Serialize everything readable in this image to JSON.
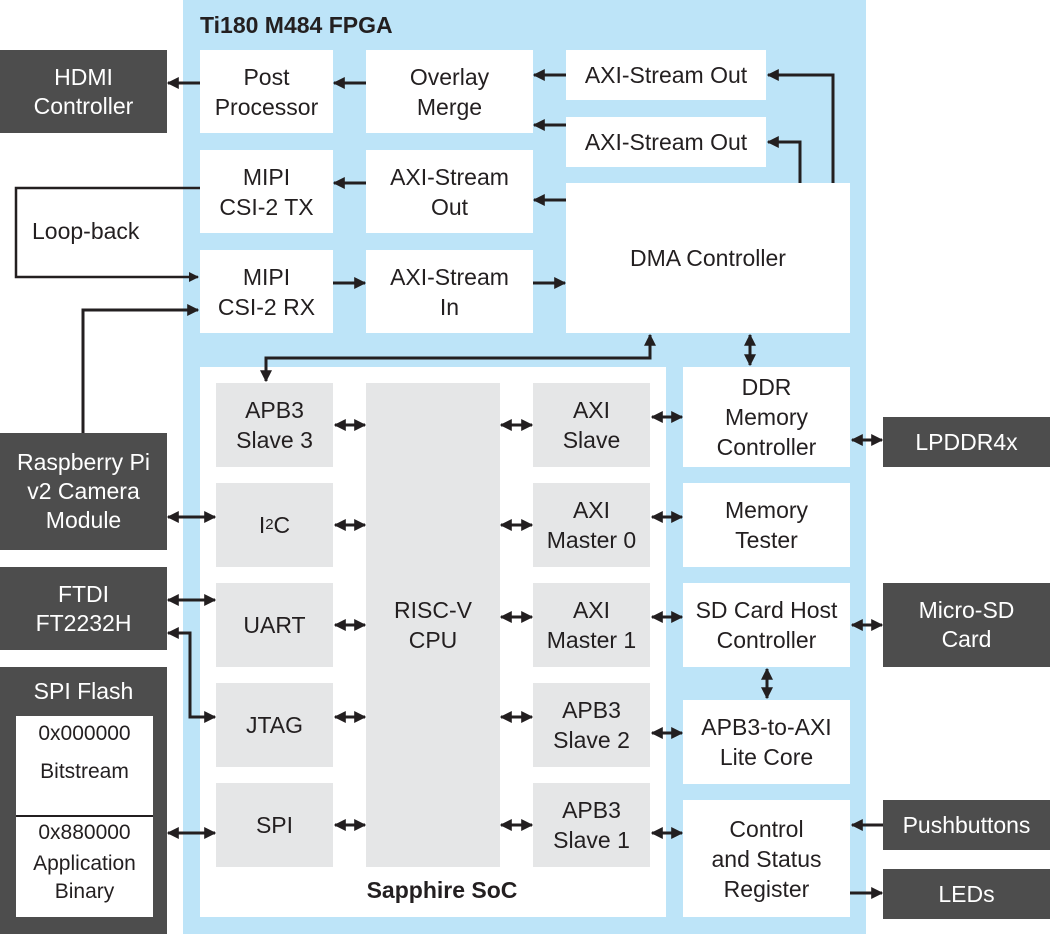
{
  "fpga": {
    "title": "Ti180 M484 FPGA"
  },
  "soc": {
    "title": "Sapphire SoC"
  },
  "video_path": {
    "post_processor": "Post\nProcessor",
    "overlay_merge": "Overlay\nMerge",
    "axi_stream_out_1": "AXI-Stream Out",
    "axi_stream_out_2": "AXI-Stream Out",
    "mipi_tx": "MIPI\nCSI-2 TX",
    "axi_stream_out_3": "AXI-Stream\nOut",
    "mipi_rx": "MIPI\nCSI-2 RX",
    "axi_stream_in": "AXI-Stream\nIn",
    "dma_controller": "DMA Controller"
  },
  "soc_blocks": {
    "apb3_slave_3": "APB3\nSlave 3",
    "i2c_base": "I",
    "i2c_sup": "2",
    "i2c_tail": "C",
    "uart": "UART",
    "jtag": "JTAG",
    "spi": "SPI",
    "cpu": "RISC-V\nCPU",
    "axi_slave": "AXI\nSlave",
    "axi_master_0": "AXI\nMaster 0",
    "axi_master_1": "AXI\nMaster 1",
    "apb3_slave_2": "APB3\nSlave 2",
    "apb3_slave_1": "APB3\nSlave 1"
  },
  "right_blocks": {
    "ddr_controller": "DDR\nMemory\nController",
    "memory_tester": "Memory\nTester",
    "sd_host": "SD Card Host\nController",
    "apb3_to_axi": "APB3-to-AXI\nLite Core",
    "csr": "Control\nand Status\nRegister"
  },
  "external": {
    "hdmi": "HDMI\nController",
    "loopback": "Loop-back",
    "camera": "Raspberry Pi\nv2 Camera\nModule",
    "ftdi": "FTDI\nFT2232H",
    "spi_flash": "SPI Flash",
    "flash_addr_1": "0x000000",
    "flash_region_1": "Bitstream",
    "flash_addr_2": "0x880000",
    "flash_region_2": "Application\nBinary",
    "lpddr": "LPDDR4x",
    "microsd": "Micro-SD\nCard",
    "pushbuttons": "Pushbuttons",
    "leds": "LEDs"
  },
  "colors": {
    "fpga_bg": "#bde4f8",
    "external_bg": "#4d4d4d",
    "soc_block_bg": "#e5e6e7",
    "wire": "#231f20"
  }
}
